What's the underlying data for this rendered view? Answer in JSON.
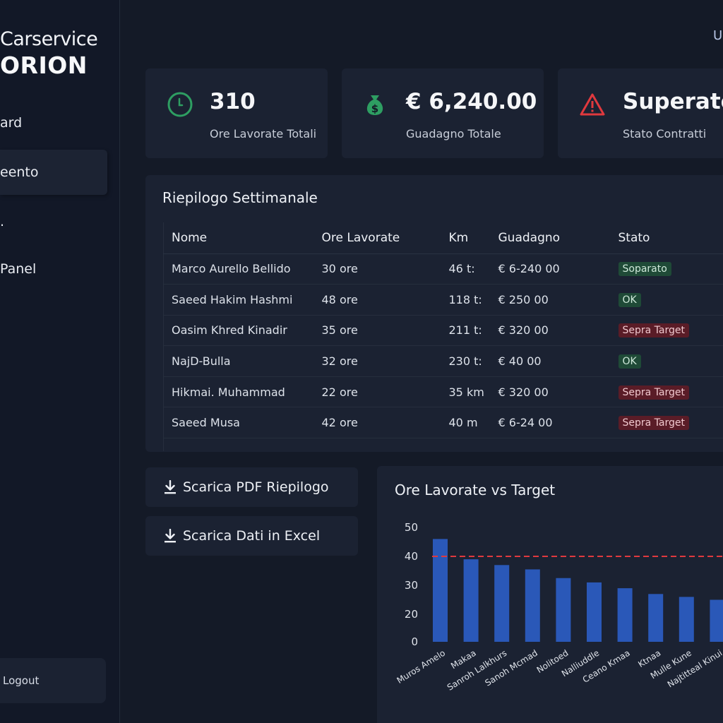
{
  "app": {
    "brand_top": "Carservice",
    "brand_main": "ORION",
    "user_label": "U"
  },
  "sidebar": {
    "items": [
      {
        "label": "ard",
        "active": false
      },
      {
        "label": "eento",
        "active": true
      },
      {
        "label": ".",
        "active": false
      },
      {
        "label": "Panel",
        "active": false
      }
    ],
    "logout": "Logout"
  },
  "kpis": [
    {
      "icon": "clock-icon",
      "value": "310",
      "label": "Ore Lavorate Totali",
      "color": "#2e9e62"
    },
    {
      "icon": "money-bag-icon",
      "value": "€ 6,240.00",
      "label": "Guadagno Totale",
      "color": "#2e9e62"
    },
    {
      "icon": "warning-icon",
      "value": "Superato",
      "label": "Stato Contratti",
      "color": "#e0393e"
    }
  ],
  "table": {
    "title": "Riepilogo Settimanale",
    "headers": [
      "Nome",
      "Ore Lavorate",
      "Km",
      "Guadagno",
      "Stato"
    ],
    "rows": [
      {
        "nome": "Marco Aurello Bellido",
        "ore": "30 ore",
        "km": "46 t:",
        "guadagno": "€ 6-240 00",
        "stato": "Soparato",
        "tone": "ok"
      },
      {
        "nome": "Saeed Hakim Hashmi",
        "ore": "48 ore",
        "km": "118 t:",
        "guadagno": "€ 250 00",
        "stato": "OK",
        "tone": "ok"
      },
      {
        "nome": "Oasim Khred Kinadir",
        "ore": "35 ore",
        "km": "211 t:",
        "guadagno": "€ 320 00",
        "stato": "Sepra Target",
        "tone": "bad"
      },
      {
        "nome": "NajD-Bulla",
        "ore": "32 ore",
        "km": "230 t:",
        "guadagno": "€ 40 00",
        "stato": "OK",
        "tone": "ok"
      },
      {
        "nome": "Hikmai. Muhammad",
        "ore": "22 ore",
        "km": "35 km",
        "guadagno": "€ 320 00",
        "stato": "Sepra Target",
        "tone": "bad"
      },
      {
        "nome": "Saeed Musa",
        "ore": "42 ore",
        "km": "40 m",
        "guadagno": "€ 6-24 00",
        "stato": "Sepra Target",
        "tone": "bad"
      }
    ]
  },
  "actions": {
    "pdf_label": "Scarica PDF Riepilogo",
    "excel_label": "Scarica Dati in Excel"
  },
  "chart_data": {
    "type": "bar",
    "title": "Ore Lavorate vs Target",
    "xlabel": "",
    "ylabel": "",
    "ylim": [
      0,
      50
    ],
    "yticks": [
      0,
      20,
      30,
      40,
      50
    ],
    "target": 40,
    "bar_color": "#2a58b8",
    "target_color": "#e0393e",
    "categories": [
      "Muros Amelo",
      "Makaa",
      "Sanroh Lalkhurs",
      "Sanoh Mcmad",
      "Nolitoed",
      "Nalliuddle",
      "Ceano Kmaa",
      "Ktnaa",
      "Mulle Kune",
      "Najtitteal Kinui"
    ],
    "values": [
      46,
      39,
      37,
      35.5,
      32.5,
      31,
      29,
      27,
      26,
      25
    ]
  }
}
